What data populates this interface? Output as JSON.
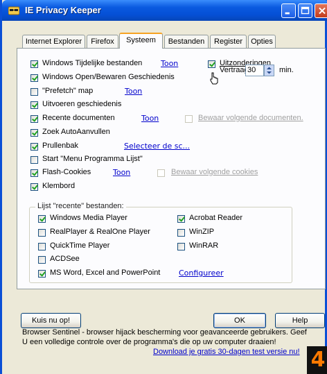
{
  "window": {
    "title": "IE Privacy Keeper",
    "icon": "app-sunglasses-icon"
  },
  "titlebar_buttons": {
    "minimize": "minimize-icon",
    "maximize": "maximize-icon",
    "close": "close-icon"
  },
  "tabs": [
    {
      "label": "Internet Explorer"
    },
    {
      "label": "Firefox"
    },
    {
      "label": "Systeem",
      "active": true
    },
    {
      "label": "Bestanden"
    },
    {
      "label": "Register"
    },
    {
      "label": "Opties"
    }
  ],
  "options": [
    {
      "label": "Windows Tijdelijke bestanden",
      "checked": true,
      "link": "Toon"
    },
    {
      "label": "Windows Open/Bewaren Geschiedenis",
      "checked": true
    },
    {
      "label": "\"Prefetch\" map",
      "checked": false,
      "link": "Toon"
    },
    {
      "label": "Uitvoeren geschiedenis",
      "checked": true
    },
    {
      "label": "Recente documenten",
      "checked": true,
      "link": "Toon",
      "extra_label": "Bewaar volgende documenten.",
      "extra_checked": false
    },
    {
      "label": "Zoek AutoAanvullen",
      "checked": true
    },
    {
      "label": "Prullenbak",
      "checked": true,
      "link": "Selecteer de sc..."
    },
    {
      "label": "Start \"Menu Programma Lijst\"",
      "checked": false
    },
    {
      "label": "Flash-Cookies",
      "checked": true,
      "link": "Toon",
      "extra_label": "Bewaar volgende cookies",
      "extra_checked": false
    },
    {
      "label": "Klembord",
      "checked": true
    }
  ],
  "exceptions": {
    "label": "Uitzonderingen",
    "checked": true
  },
  "delay": {
    "label": "Vertraagde",
    "value": "30",
    "unit": "min."
  },
  "recent_group": {
    "legend": "Lijst \"recente\" bestanden:",
    "left": [
      {
        "label": "Windows Media Player",
        "checked": true
      },
      {
        "label": "RealPlayer & RealOne Player",
        "checked": false
      },
      {
        "label": "QuickTime Player",
        "checked": false
      },
      {
        "label": "ACDSee",
        "checked": false
      },
      {
        "label": "MS Word, Excel and PowerPoint",
        "checked": true,
        "link": "Configureer"
      }
    ],
    "right": [
      {
        "label": "Acrobat Reader",
        "checked": true
      },
      {
        "label": "WinZIP",
        "checked": false
      },
      {
        "label": "WinRAR",
        "checked": false
      }
    ]
  },
  "buttons": {
    "quiz": "Kuis nu op!",
    "ok": "OK",
    "help": "Help"
  },
  "footer": {
    "line1": "Browser Sentinel - browser hijack bescherming voor geavanceerde gebruikers. Geef",
    "line2": "U een volledige controle over de programma's die op uw computer draaien!",
    "link": "Download je gratis 30-dagen test versie nu!"
  },
  "badge": "4"
}
